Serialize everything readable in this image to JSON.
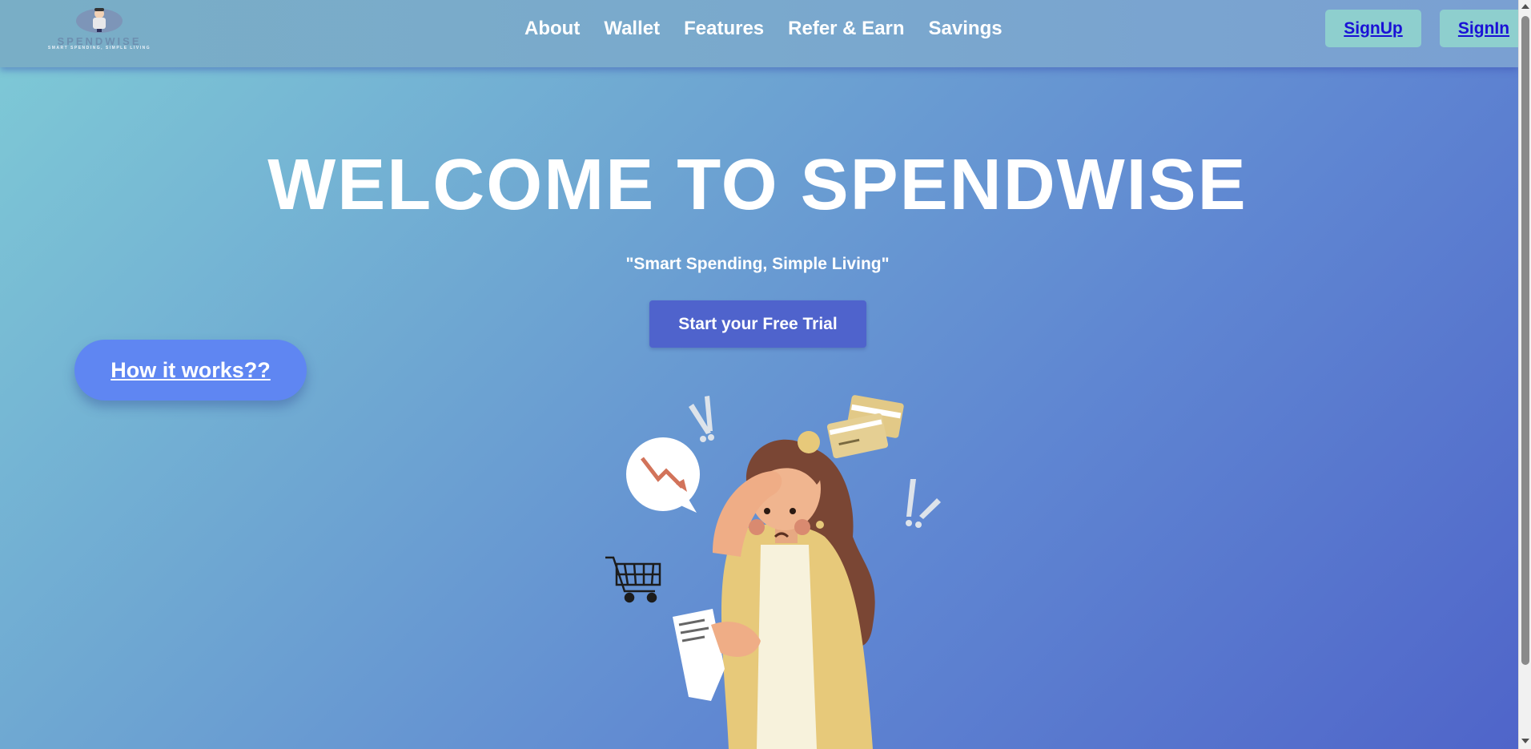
{
  "brand": {
    "name": "SPENDWISE",
    "sub": "SMART SPENDING, SIMPLE LIVING"
  },
  "nav": {
    "items": [
      {
        "label": "About"
      },
      {
        "label": "Wallet"
      },
      {
        "label": "Features"
      },
      {
        "label": "Refer & Earn"
      },
      {
        "label": "Savings"
      }
    ],
    "signup_label": "SignUp",
    "signin_label": "SignIn"
  },
  "hero": {
    "title": "WELCOME TO SPENDWISE",
    "tagline": "\"Smart Spending, Simple Living\"",
    "cta_label": "Start your Free Trial",
    "how_label": "How it works??"
  },
  "colors": {
    "accent": "#4f63cc",
    "how_button": "#5f86f2",
    "auth_button_bg": "#8ecfce",
    "auth_button_text": "#1a10d6"
  },
  "icons": [
    "logo-mascot-icon",
    "stressed-woman-illustration",
    "shopping-cart-icon",
    "credit-cards-icon",
    "falling-graph-icon",
    "exclamation-icon"
  ]
}
